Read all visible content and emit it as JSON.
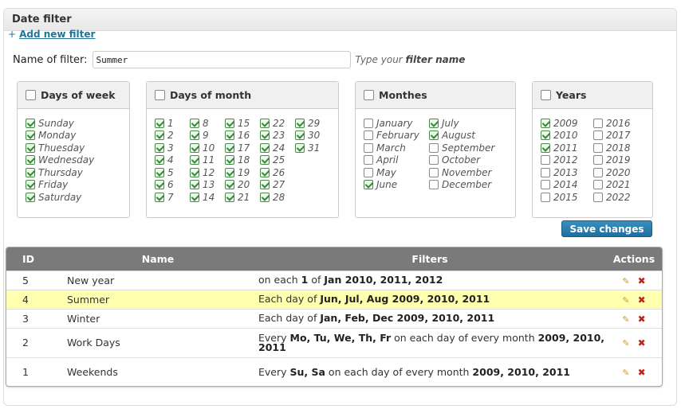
{
  "panel": {
    "title": "Date filter"
  },
  "add_filter": {
    "plus": "+",
    "label": "Add new filter"
  },
  "name_row": {
    "label": "Name of filter:",
    "value": "Summer",
    "hint_prefix": "Type your ",
    "hint_bold": "filter name"
  },
  "days_of_week": {
    "title": "Days of week",
    "items": [
      {
        "label": "Sunday",
        "checked": true
      },
      {
        "label": "Monday",
        "checked": true
      },
      {
        "label": "Thuesday",
        "checked": true
      },
      {
        "label": "Wednesday",
        "checked": true
      },
      {
        "label": "Thursday",
        "checked": true
      },
      {
        "label": "Friday",
        "checked": true
      },
      {
        "label": "Saturday",
        "checked": true
      }
    ]
  },
  "days_of_month": {
    "title": "Days of month",
    "columns": [
      [
        {
          "label": "1",
          "checked": true
        },
        {
          "label": "2",
          "checked": true
        },
        {
          "label": "3",
          "checked": true
        },
        {
          "label": "4",
          "checked": true
        },
        {
          "label": "5",
          "checked": true
        },
        {
          "label": "6",
          "checked": true
        },
        {
          "label": "7",
          "checked": true
        }
      ],
      [
        {
          "label": "8",
          "checked": true
        },
        {
          "label": "9",
          "checked": true
        },
        {
          "label": "10",
          "checked": true
        },
        {
          "label": "11",
          "checked": true
        },
        {
          "label": "12",
          "checked": true
        },
        {
          "label": "13",
          "checked": true
        },
        {
          "label": "14",
          "checked": true
        }
      ],
      [
        {
          "label": "15",
          "checked": true
        },
        {
          "label": "16",
          "checked": true
        },
        {
          "label": "17",
          "checked": true
        },
        {
          "label": "18",
          "checked": true
        },
        {
          "label": "19",
          "checked": true
        },
        {
          "label": "20",
          "checked": true
        },
        {
          "label": "21",
          "checked": true
        }
      ],
      [
        {
          "label": "22",
          "checked": true
        },
        {
          "label": "23",
          "checked": true
        },
        {
          "label": "24",
          "checked": true
        },
        {
          "label": "25",
          "checked": true
        },
        {
          "label": "26",
          "checked": true
        },
        {
          "label": "27",
          "checked": true
        },
        {
          "label": "28",
          "checked": true
        }
      ],
      [
        {
          "label": "29",
          "checked": true
        },
        {
          "label": "30",
          "checked": true
        },
        {
          "label": "31",
          "checked": true
        }
      ]
    ]
  },
  "monthes": {
    "title": "Monthes",
    "columns": [
      [
        {
          "label": "January",
          "checked": false
        },
        {
          "label": "February",
          "checked": false
        },
        {
          "label": "March",
          "checked": false
        },
        {
          "label": "April",
          "checked": false
        },
        {
          "label": "May",
          "checked": false
        },
        {
          "label": "June",
          "checked": true
        }
      ],
      [
        {
          "label": "July",
          "checked": true
        },
        {
          "label": "August",
          "checked": true
        },
        {
          "label": "September",
          "checked": false
        },
        {
          "label": "October",
          "checked": false
        },
        {
          "label": "November",
          "checked": false
        },
        {
          "label": "December",
          "checked": false
        }
      ]
    ]
  },
  "years": {
    "title": "Years",
    "columns": [
      [
        {
          "label": "2009",
          "checked": true
        },
        {
          "label": "2010",
          "checked": true
        },
        {
          "label": "2011",
          "checked": true
        },
        {
          "label": "2012",
          "checked": false
        },
        {
          "label": "2013",
          "checked": false
        },
        {
          "label": "2014",
          "checked": false
        },
        {
          "label": "2015",
          "checked": false
        }
      ],
      [
        {
          "label": "2016",
          "checked": false
        },
        {
          "label": "2017",
          "checked": false
        },
        {
          "label": "2018",
          "checked": false
        },
        {
          "label": "2019",
          "checked": false
        },
        {
          "label": "2020",
          "checked": false
        },
        {
          "label": "2021",
          "checked": false
        },
        {
          "label": "2022",
          "checked": false
        }
      ]
    ]
  },
  "save_button": {
    "label": "Save changes"
  },
  "table": {
    "headers": {
      "id": "ID",
      "name": "Name",
      "filters": "Filters",
      "actions": "Actions"
    },
    "rows": [
      {
        "id": "5",
        "name": "New year",
        "highlight": false,
        "filter": [
          {
            "t": "on each ",
            "b": false
          },
          {
            "t": "1",
            "b": true
          },
          {
            "t": " of ",
            "b": false
          },
          {
            "t": "Jan 2010, 2011, 2012",
            "b": true
          }
        ]
      },
      {
        "id": "4",
        "name": "Summer",
        "highlight": true,
        "filter": [
          {
            "t": "Each day of ",
            "b": false
          },
          {
            "t": "Jun, Jul, Aug 2009, 2010, 2011",
            "b": true
          }
        ]
      },
      {
        "id": "3",
        "name": "Winter",
        "highlight": false,
        "filter": [
          {
            "t": "Each day of ",
            "b": false
          },
          {
            "t": "Jan, Feb, Dec 2009, 2010, 2011",
            "b": true
          }
        ]
      },
      {
        "id": "2",
        "name": "Work Days",
        "highlight": false,
        "filter": [
          {
            "t": "Every ",
            "b": false
          },
          {
            "t": "Mo, Tu, We, Th, Fr",
            "b": true
          },
          {
            "t": " on each day of every month ",
            "b": false
          },
          {
            "t": "2009, 2010, 2011",
            "b": true
          }
        ]
      },
      {
        "id": "1",
        "name": "Weekends",
        "highlight": false,
        "filter": [
          {
            "t": "Every ",
            "b": false
          },
          {
            "t": "Su, Sa",
            "b": true
          },
          {
            "t": " on each day of every month ",
            "b": false
          },
          {
            "t": "2009, 2010, 2011",
            "b": true
          }
        ]
      }
    ],
    "edit_icon": "pencil-icon",
    "delete_icon": "x-icon"
  }
}
